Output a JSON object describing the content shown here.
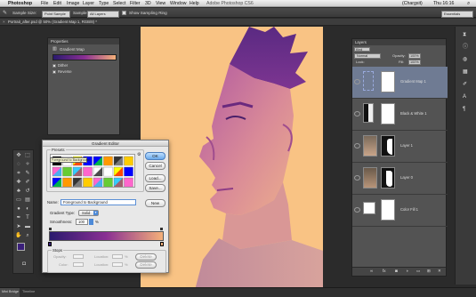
{
  "menubar": {
    "app": "Photoshop",
    "items": [
      "File",
      "Edit",
      "Image",
      "Layer",
      "Type",
      "Select",
      "Filter",
      "3D",
      "View",
      "Window",
      "Help"
    ],
    "title": "Adobe Photoshop CS6",
    "clock": "Thu 16:16",
    "user": "(Chargsit)"
  },
  "options": {
    "sample_size_label": "Sample Size:",
    "sample_size_value": "Point Sample",
    "sample_label": "Sample:",
    "sample_value": "All Layers",
    "show_ring_label": "Show Sampling Ring",
    "workspace": "Essentials"
  },
  "document_tab": "Portrait_after.psd @ 50% (Gradient Map 1, RGB/8) *",
  "properties": {
    "title": "Properties",
    "section": "Gradient Map",
    "dither": "Dither",
    "reverse": "Reverse"
  },
  "layers": {
    "tab": "Layers",
    "blend_mode": "Normal",
    "opacity_label": "Opacity:",
    "opacity_value": "100%",
    "fill_label": "Fill:",
    "fill_value": "100%",
    "lock_label": "Lock:",
    "kind_label": "Kind",
    "rows": [
      {
        "name": "Gradient Map 1"
      },
      {
        "name": "Black & White 1"
      },
      {
        "name": "Layer 1"
      },
      {
        "name": "Layer 0"
      },
      {
        "name": "Color Fill 1"
      }
    ]
  },
  "gradient_editor": {
    "title": "Gradient Editor",
    "presets_label": "Presets",
    "tooltip": "Foreground to Background",
    "ok": "OK",
    "cancel": "Cancel",
    "load": "Load...",
    "save": "Save...",
    "name_label": "Name:",
    "name_value": "Foreground to Background",
    "new": "New",
    "gradient_type_label": "Gradient Type:",
    "gradient_type_value": "Solid",
    "smoothness_label": "Smoothness:",
    "smoothness_value": "100",
    "smoothness_unit": "%",
    "stops_label": "Stops",
    "opacity_label": "Opacity:",
    "location_label": "Location:",
    "location_unit": "%",
    "delete": "Delete",
    "color_label": "Color:",
    "gradient_colors": [
      "#2a1a6e",
      "#8a2f93",
      "#f5b079"
    ]
  },
  "statusbar": {
    "left_tab": "Mini Bridge",
    "right_tab": "Timeline"
  },
  "colors": {
    "foreground": "#3a1f7a",
    "background": "#f9c384"
  }
}
